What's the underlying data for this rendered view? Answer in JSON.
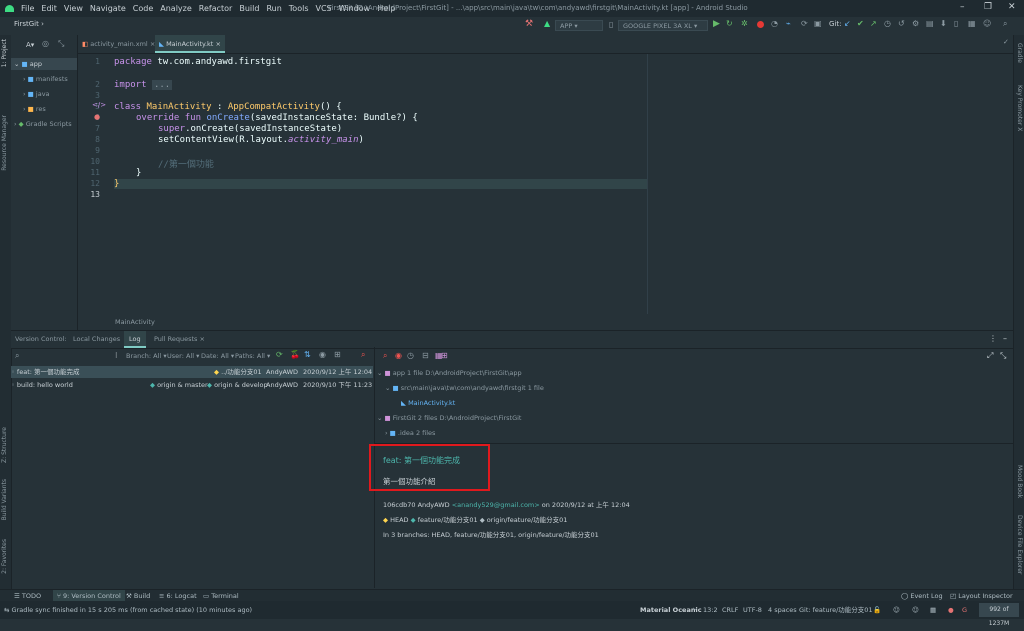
{
  "menu": {
    "items": [
      "File",
      "Edit",
      "View",
      "Navigate",
      "Code",
      "Analyze",
      "Refactor",
      "Build",
      "Run",
      "Tools",
      "VCS",
      "Window",
      "Help"
    ],
    "title": "FirstGit [D:\\AndroidProject\\FirstGit] - ...\\app\\src\\main\\java\\tw\\com\\andyawd\\firstgit\\MainActivity.kt [app] - Android Studio"
  },
  "navbar": {
    "project": "FirstGit",
    "run_config": "APP",
    "device": "GOOGLE PIXEL 3A XL",
    "git_label": "Git:"
  },
  "left_stripe": {
    "project": "1: Project",
    "resource_manager": "Resource Manager",
    "structure": "Z: Structure",
    "build_variants": "Build Variants",
    "favorites": "2: Favorites"
  },
  "right_stripe": {
    "gradle": "Gradle",
    "key_promoter": "Key Promoter X",
    "mood_book": "Mood Book",
    "device_file_explorer": "Device File Explorer"
  },
  "project_panel": {
    "header": "A",
    "tree": [
      "app",
      "manifests",
      "java",
      "res",
      "Gradle Scripts"
    ]
  },
  "editor": {
    "tabs": [
      "activity_main.xml",
      "MainActivity.kt"
    ],
    "line_numbers": [
      "1",
      "2",
      "3",
      "5",
      "6",
      "7",
      "8",
      "9",
      "10",
      "11",
      "12",
      "13"
    ],
    "lines": {
      "l1_kw": "package",
      "l1_rest": " tw.com.andyawd.firstgit",
      "l3_kw": "import",
      "l3_fold": "...",
      "l5_kw": "class",
      "l5_name": " MainActivity",
      "l5_rest": " : ",
      "l5_parent": "AppCompatActivity",
      "l5_end": "() {",
      "l6_kw": "override fun",
      "l6_fn": " onCreate",
      "l6_rest": "(savedInstanceState: Bundle?) {",
      "l7_kw": "super",
      "l7_rest": ".onCreate(savedInstanceState)",
      "l8_rest": "setContentView(R.layout.",
      "l8_it": "activity_main",
      "l8_end": ")",
      "l10_cm": "//第一個功能",
      "l11": "}",
      "l12": "}"
    },
    "breadcrumb": "MainActivity"
  },
  "vc_panel": {
    "tabs": [
      "Version Control:",
      "Local Changes",
      "Log",
      "Pull Requests"
    ],
    "filters": [
      "Branch: All",
      "User: All",
      "Date: All",
      "Paths: All"
    ],
    "commits": [
      {
        "subject": "feat: 第一個功能完成",
        "refs": "../功能分支01",
        "author": "AndyAWD",
        "date": "2020/9/12 上午 12:04"
      },
      {
        "subject": "build: hello world",
        "refs": "origin & master",
        "refs2": "origin & develop",
        "author": "AndyAWD",
        "date": "2020/9/10 下午 11:23"
      }
    ]
  },
  "detail": {
    "tree": [
      "app  1 file  D:\\AndroidProject\\FirstGit\\app",
      "src\\main\\java\\tw\\com\\andyawd\\firstgit  1 file",
      "MainActivity.kt",
      "FirstGit  2 files  D:\\AndroidProject\\FirstGit",
      ".idea  2 files"
    ],
    "commit_title": "feat: 第一個功能完成",
    "commit_body": "第一個功能介紹",
    "hash_author": "106cdb70 AndyAWD",
    "email": "<anandy529@gmail.com>",
    "date_text": " on 2020/9/12 at 上午 12:04",
    "refs": [
      "HEAD",
      "feature/功能分支01",
      "origin/feature/功能分支01"
    ],
    "branches_text": "In 3 branches: HEAD, feature/功能分支01, origin/feature/功能分支01"
  },
  "tool_windows": {
    "todo": "TODO",
    "version_control": "9: Version Control",
    "build": "Build",
    "logcat": "6: Logcat",
    "terminal": "Terminal",
    "event_log": "Event Log",
    "layout_inspector": "Layout Inspector"
  },
  "status": {
    "message": "Gradle sync finished in 15 s 205 ms (from cached state) (10 minutes ago)",
    "theme": "Material Oceanic",
    "position": "13:2",
    "line_sep": "CRLF",
    "encoding": "UTF-8",
    "indent": "4 spaces",
    "git": "Git: feature/功能分支01",
    "memory": "992 of 1237M"
  },
  "colors": {
    "accent": "#80cbc4",
    "highlight_box": "#e0191d",
    "background": "#263238"
  }
}
